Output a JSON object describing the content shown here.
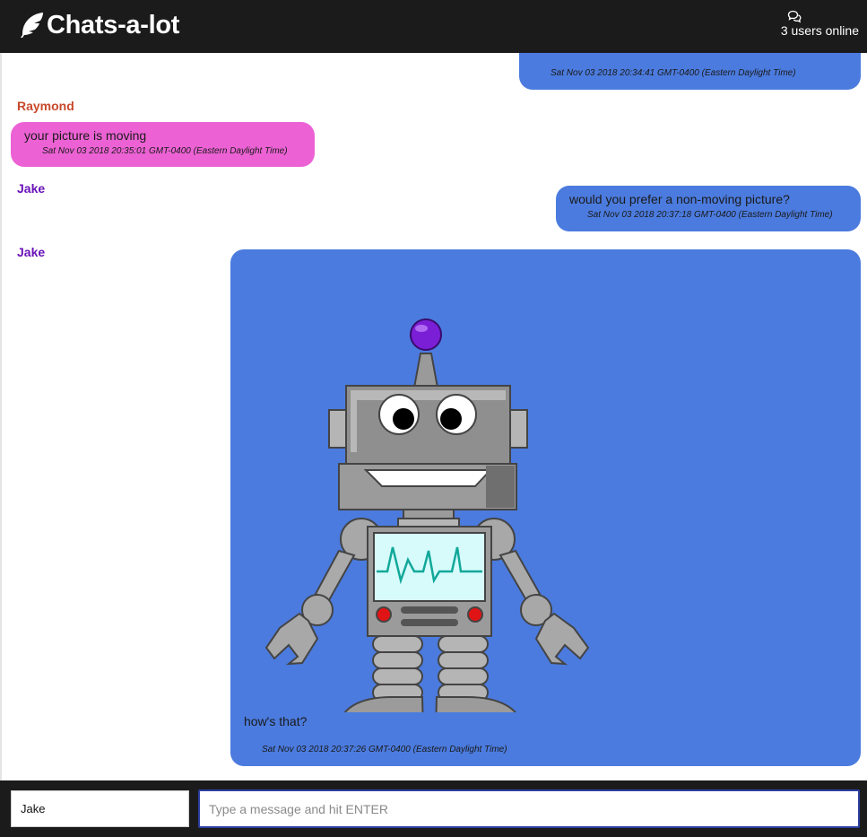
{
  "header": {
    "app_title": "Chats-a-lot",
    "online_text": "3 users online"
  },
  "messages": [
    {
      "sender": "",
      "text": "",
      "time": "Sat Nov 03 2018 20:34:41 GMT-0400 (Eastern Daylight Time)",
      "own": true
    },
    {
      "sender": "Raymond",
      "text": "your picture is moving",
      "time": "Sat Nov 03 2018 20:35:01 GMT-0400 (Eastern Daylight Time)",
      "own": false
    },
    {
      "sender": "Jake",
      "text": "would you prefer a non-moving picture?",
      "time": "Sat Nov 03 2018 20:37:18 GMT-0400 (Eastern Daylight Time)",
      "own": true
    },
    {
      "sender": "Jake",
      "text": "how's that?",
      "time": "Sat Nov 03 2018 20:37:26 GMT-0400 (Eastern Daylight Time)",
      "own": true,
      "has_image": true
    }
  ],
  "colors": {
    "header_bg": "#1b1b1c",
    "own_bubble": "#4b7bde",
    "raymond_bubble": "#ec62d4",
    "raymond_name": "#c8492c",
    "jake_name": "#6a12b8"
  },
  "footer": {
    "name_value": "Jake",
    "message_placeholder": "Type a message and hit ENTER"
  }
}
